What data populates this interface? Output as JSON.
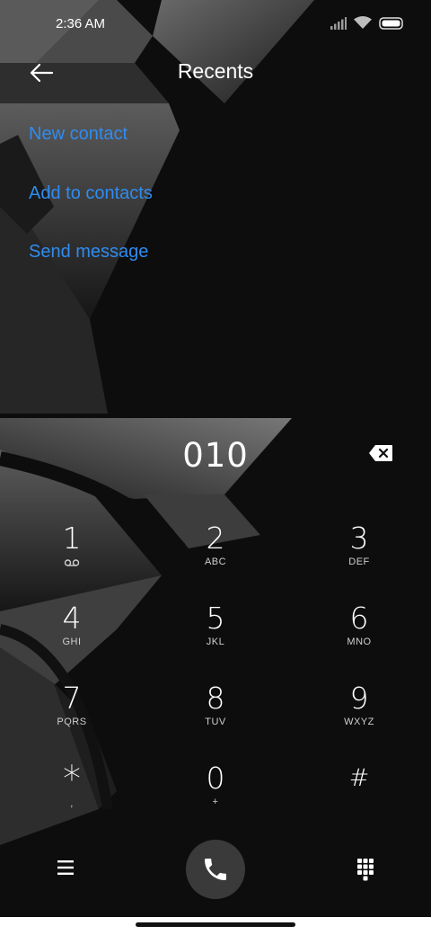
{
  "status_bar": {
    "time": "2:36 AM",
    "icons": [
      "signal-icon",
      "wifi-icon",
      "battery-icon"
    ]
  },
  "header": {
    "back_icon": "arrow-left-icon",
    "title": "Recents"
  },
  "actions": [
    {
      "label": "New contact"
    },
    {
      "label": "Add to contacts"
    },
    {
      "label": "Send message"
    }
  ],
  "dialpad": {
    "number": "010",
    "backspace_icon": "backspace-icon",
    "keys": [
      {
        "digit": "1",
        "letters": "",
        "sub_icon": "voicemail-icon"
      },
      {
        "digit": "2",
        "letters": "ABC"
      },
      {
        "digit": "3",
        "letters": "DEF"
      },
      {
        "digit": "4",
        "letters": "GHI"
      },
      {
        "digit": "5",
        "letters": "JKL"
      },
      {
        "digit": "6",
        "letters": "MNO"
      },
      {
        "digit": "7",
        "letters": "PQRS"
      },
      {
        "digit": "8",
        "letters": "TUV"
      },
      {
        "digit": "9",
        "letters": "WXYZ"
      },
      {
        "digit": "*",
        "letters": ","
      },
      {
        "digit": "0",
        "letters": "+"
      },
      {
        "digit": "#",
        "letters": ""
      }
    ]
  },
  "bottom_bar": {
    "menu_icon": "hamburger-menu-icon",
    "call_icon": "phone-icon",
    "keypad_icon": "dialpad-icon"
  },
  "colors": {
    "background": "#0d0d0d",
    "accent_link": "#2f8cf0",
    "call_button": "#3a3a3a",
    "nav_bar": "#ffffff"
  }
}
